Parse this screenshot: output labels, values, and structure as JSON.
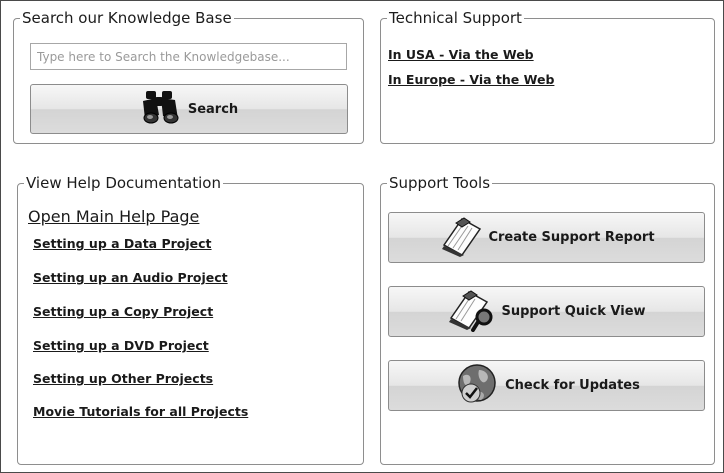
{
  "search_section": {
    "legend": "Search our Knowledge Base",
    "placeholder": "Type here to Search the Knowledgebase...",
    "button_label": "Search",
    "button_icon": "binoculars-icon"
  },
  "tech_support": {
    "legend": "Technical Support",
    "links": [
      "In USA - Via the Web",
      "In Europe - Via the Web"
    ]
  },
  "help_docs": {
    "legend": "View Help Documentation",
    "main_link": "Open Main Help Page",
    "links": [
      "Setting up a Data Project",
      "Setting up an Audio Project",
      "Setting up a Copy Project",
      "Setting up a DVD Project",
      "Setting up Other Projects",
      "Movie Tutorials for all Projects"
    ]
  },
  "support_tools": {
    "legend": "Support Tools",
    "buttons": [
      {
        "label": "Create Support Report",
        "icon": "notepad-icon"
      },
      {
        "label": "Support Quick View",
        "icon": "notepad-magnifier-icon"
      },
      {
        "label": "Check for Updates",
        "icon": "globe-check-icon"
      }
    ]
  }
}
